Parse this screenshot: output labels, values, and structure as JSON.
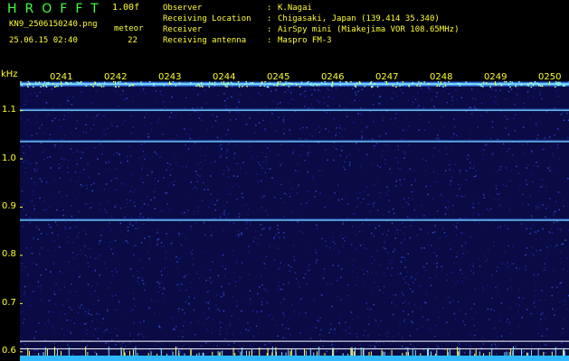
{
  "header": {
    "app_title": "HROFFT",
    "version": "1.00f",
    "filename": "KN9_2506150240.png",
    "datetime": "25.06.15 02:40",
    "meteor_label": "meteor",
    "meteor_count": "22"
  },
  "info": [
    {
      "key": "Observer",
      "value": "K.Nagai"
    },
    {
      "key": "Receiving Location",
      "value": "Chigasaki, Japan (139.414 35.340)"
    },
    {
      "key": "Receiver",
      "value": "AirSpy mini (Miakejima VOR 108.65MHz)"
    },
    {
      "key": "Receiving antenna",
      "value": "Maspro FM-3"
    }
  ],
  "chart_data": {
    "type": "heatmap",
    "y_unit": "kHz",
    "y_ticks": [
      "1.1",
      "1.0",
      "0.9",
      "0.8",
      "0.7",
      "0.6"
    ],
    "y_tick_values": [
      1.1,
      1.0,
      0.9,
      0.8,
      0.7,
      0.6
    ],
    "x_ticks": [
      "0241",
      "0242",
      "0243",
      "0244",
      "0245",
      "0246",
      "0247",
      "0248",
      "0249",
      "0250"
    ],
    "ylim": [
      0.58,
      1.16
    ],
    "carrier_lines_khz": [
      1.155,
      1.1,
      1.035,
      0.872
    ],
    "reference_lines_khz": [
      0.622,
      0.606
    ],
    "colors": {
      "background": "#0a0a44",
      "carrier": "#7fd8ff",
      "reference": "#ffffff",
      "text": "#ffff33",
      "title": "#44ff44"
    }
  }
}
